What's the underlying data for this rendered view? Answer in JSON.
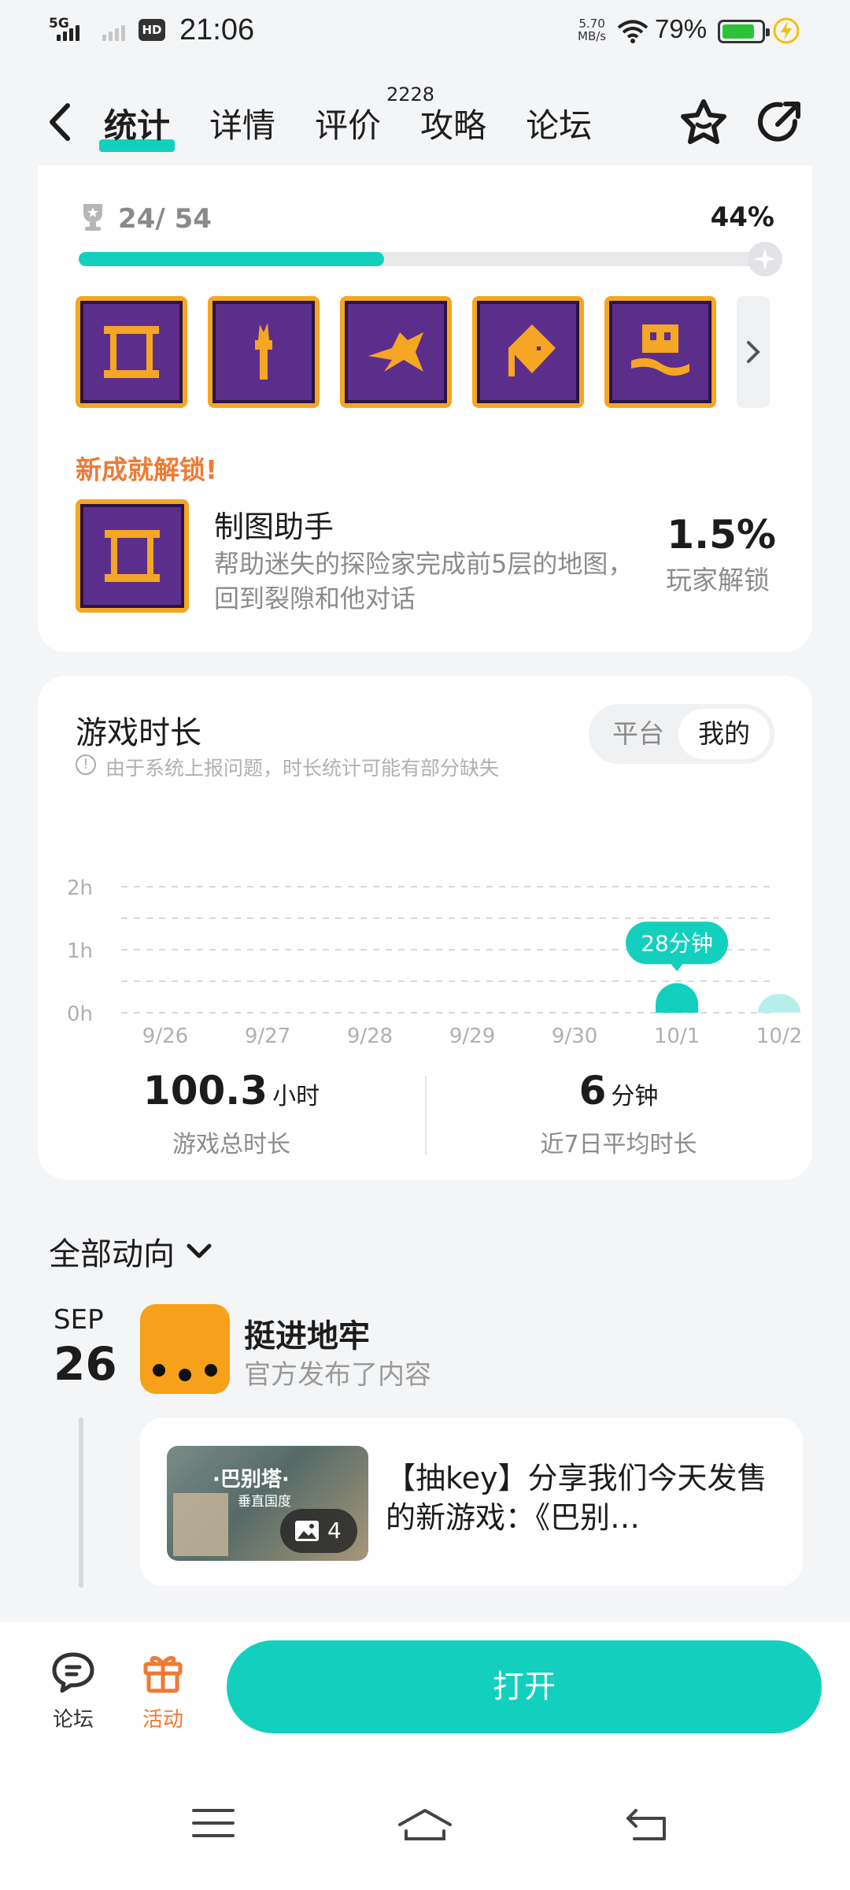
{
  "status_bar": {
    "network": "5G",
    "hd": "HD",
    "time": "21:06",
    "speed_value": "5.70",
    "speed_unit": "MB/s",
    "battery": "79%"
  },
  "header": {
    "tabs": [
      {
        "label": "统计",
        "active": true
      },
      {
        "label": "详情"
      },
      {
        "label": "评价",
        "badge": "2228"
      },
      {
        "label": "攻略"
      },
      {
        "label": "论坛"
      }
    ]
  },
  "achievements": {
    "count": "24/ 54",
    "percent": "44%",
    "progress": 0.44,
    "icons": [
      "scroll-achievement-icon",
      "torch-achievement-icon",
      "creature-achievement-icon",
      "card-achievement-icon",
      "tower-achievement-icon"
    ],
    "new_label": "新成就解锁!",
    "new_name": "制图助手",
    "new_desc": "帮助迷失的探险家完成前5层的地图，回到裂隙和他对话",
    "new_rate": "1.5%",
    "new_rate_label": "玩家解锁"
  },
  "playtime": {
    "title": "游戏时长",
    "note": "由于系统上报问题，时长统计可能有部分缺失",
    "toggle": {
      "platform": "平台",
      "mine": "我的",
      "selected": "mine"
    },
    "total_value": "100.3",
    "total_unit": "小时",
    "total_label": "游戏总时长",
    "avg_value": "6",
    "avg_unit": "分钟",
    "avg_label": "近7日平均时长"
  },
  "chart_data": {
    "type": "bar",
    "categories": [
      "9/26",
      "9/27",
      "9/28",
      "9/29",
      "9/30",
      "10/1",
      "10/2"
    ],
    "values": [
      0,
      0,
      0,
      0,
      0,
      0.47,
      0.3
    ],
    "y_ticks": [
      "0h",
      "1h",
      "2h"
    ],
    "ylim": [
      0,
      2
    ],
    "highlight_label": "28分钟",
    "highlight_index": 5,
    "grid": true,
    "colors": {
      "bar": "#12d0bd",
      "bar_faded": "#b8eeea"
    }
  },
  "activity": {
    "title": "全部动向",
    "month": "SEP",
    "day": "26",
    "game_name": "挺进地牢",
    "game_sub": "官方发布了内容",
    "post_text": "【抽key】分享我们今天发售的新游戏：《巴别…",
    "thumb_title": "·巴别塔·",
    "thumb_subtitle": "垂直国度",
    "thumb_count": "4"
  },
  "bottom_bar": {
    "forum": "论坛",
    "activity": "活动",
    "open": "打开"
  },
  "colors": {
    "accent": "#12d0bd",
    "orange": "#ef7a34",
    "achievement_frame": "#f5a623",
    "achievement_bg": "#5c2e8c"
  }
}
